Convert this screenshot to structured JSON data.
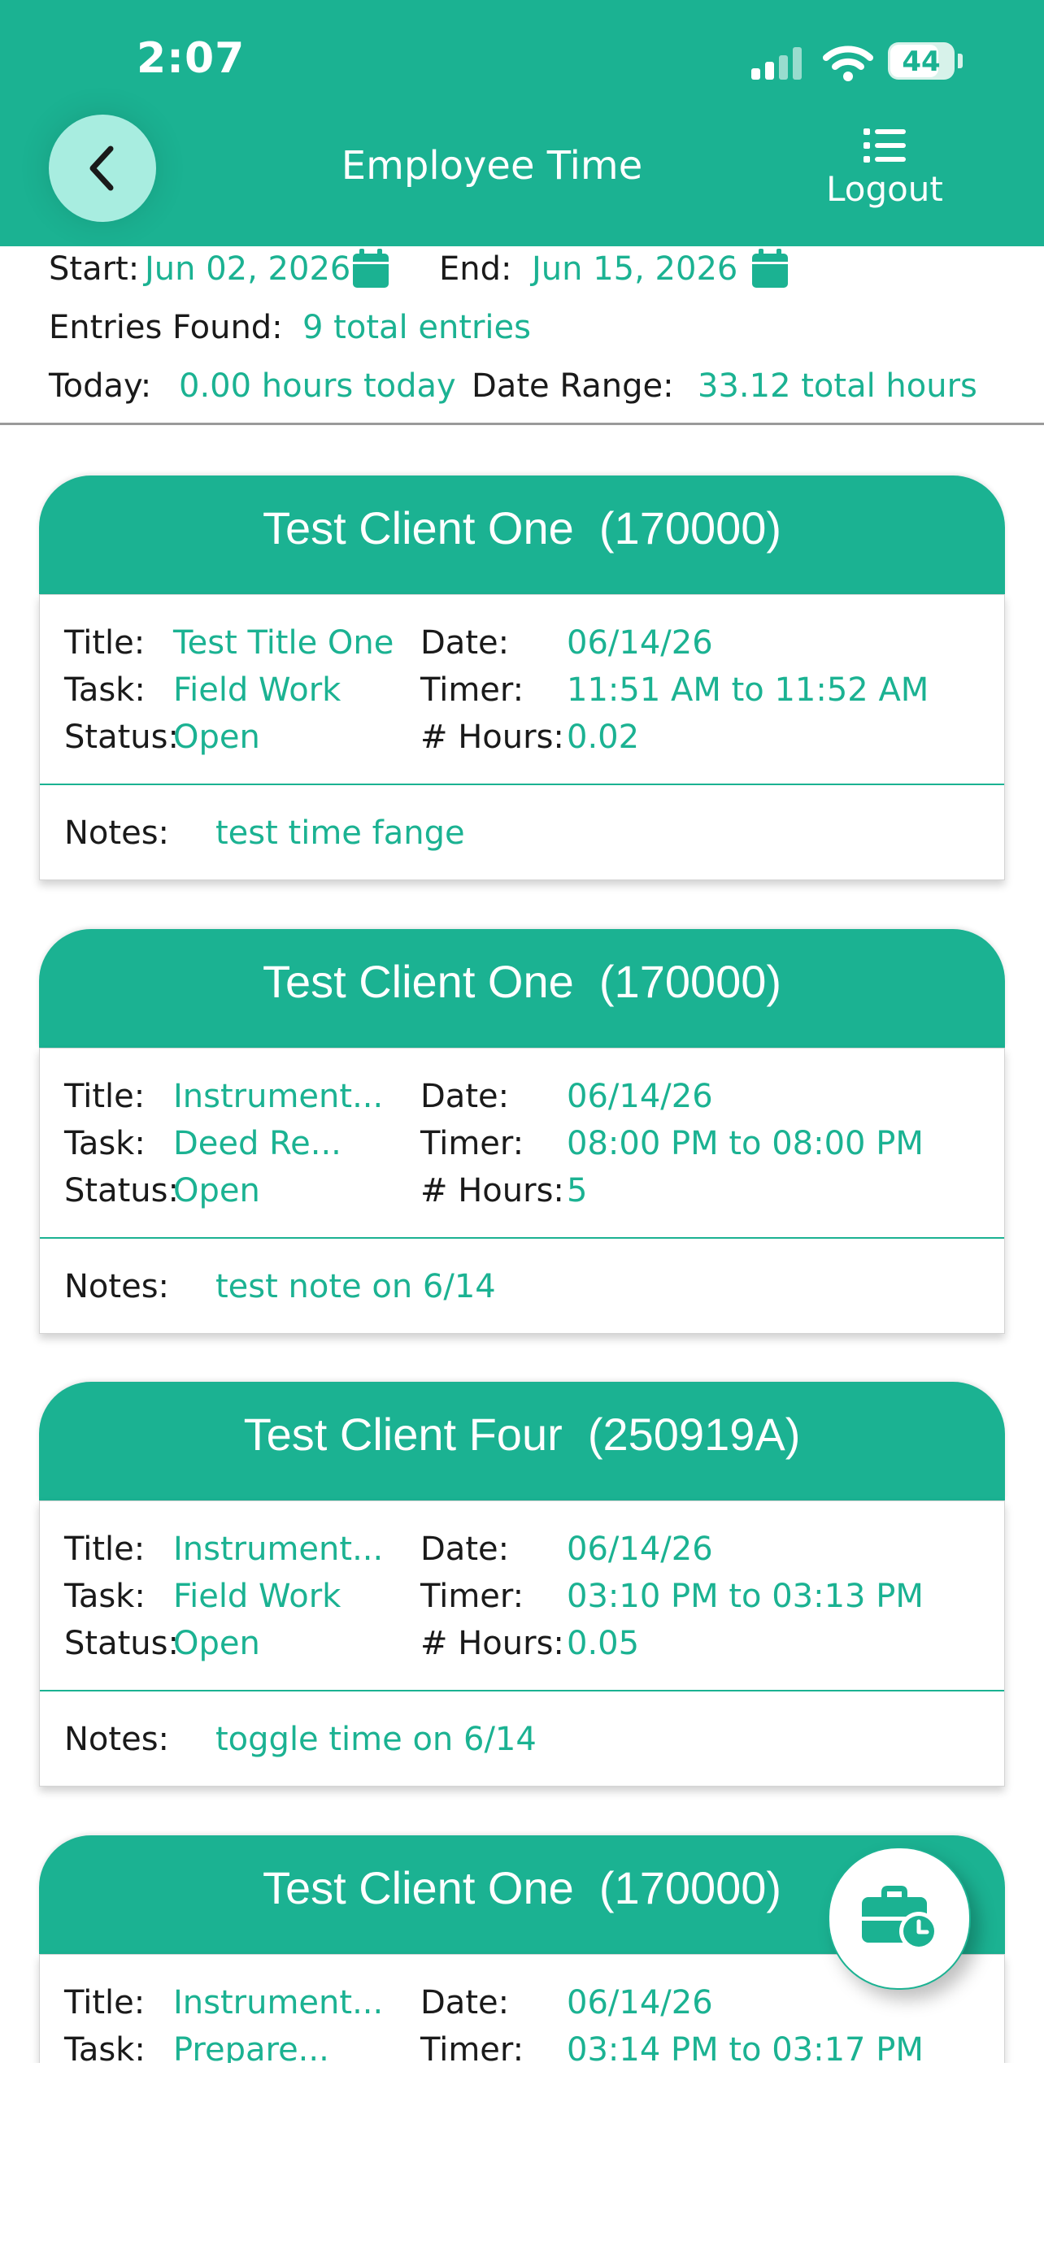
{
  "status_bar": {
    "time": "2:07",
    "battery": "44"
  },
  "header": {
    "title": "Employee Time",
    "logout_label": "Logout"
  },
  "summary": {
    "start_label": "Start:",
    "start_value": "Jun 02, 2026",
    "end_label": "End:",
    "end_value": "Jun 15, 2026",
    "entries_label": "Entries Found:",
    "entries_value": "9 total entries",
    "today_label": "Today:",
    "today_value": "0.00 hours today",
    "range_label": "Date Range:",
    "range_value": "33.12 total hours"
  },
  "labels": {
    "title": "Title:",
    "task": "Task:",
    "status": "Status:",
    "date": "Date:",
    "timer": "Timer:",
    "hours": "# Hours:",
    "notes": "Notes:"
  },
  "entries": [
    {
      "client": "Test Client One  (170000)",
      "title": "Test Title One",
      "task": "Field Work",
      "status": "Open",
      "date": "06/14/26",
      "timer": "11:51 AM to 11:52 AM",
      "hours": "0.02",
      "notes": "test time fange"
    },
    {
      "client": "Test Client One  (170000)",
      "title": "Instrument...",
      "task": "Deed Re...",
      "status": "Open",
      "date": "06/14/26",
      "timer": "08:00 PM to 08:00 PM",
      "hours": "5",
      "notes": "test note on 6/14"
    },
    {
      "client": "Test Client Four  (250919A)",
      "title": "Instrument...",
      "task": "Field Work",
      "status": "Open",
      "date": "06/14/26",
      "timer": "03:10 PM to 03:13 PM",
      "hours": "0.05",
      "notes": "toggle time on 6/14"
    },
    {
      "client": "Test Client One  (170000)",
      "title": "Instrument...",
      "task": "Prepare...",
      "date": "06/14/26",
      "timer": "03:14 PM to 03:17 PM"
    }
  ],
  "colors": {
    "accent": "#1bb292",
    "back_button": "#a8ede0",
    "text": "#1a1a1a"
  },
  "icons": {
    "back": "chevron-left-icon",
    "menu": "list-icon",
    "calendar": "calendar-icon",
    "fab": "briefcase-clock-icon"
  }
}
